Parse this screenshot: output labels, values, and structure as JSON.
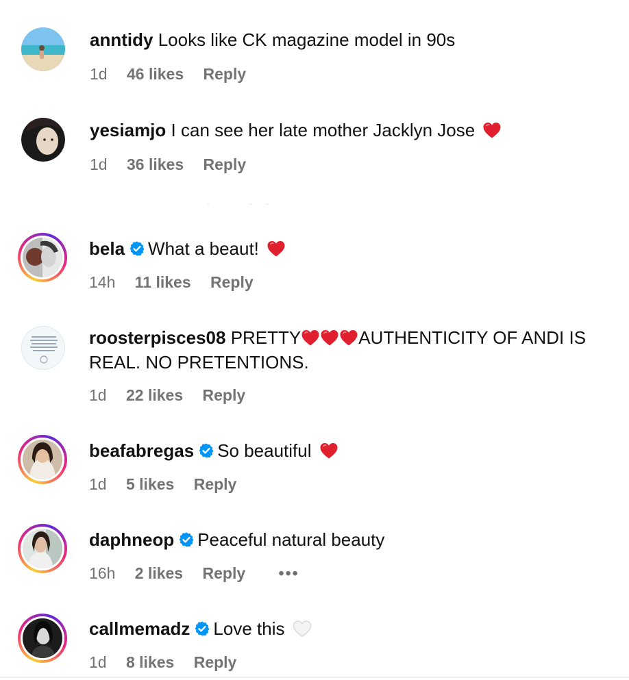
{
  "comments": [
    {
      "username": "anntidy",
      "text": "Looks like CK magazine model in 90s",
      "time": "1d",
      "likes": "46 likes",
      "reply": "Reply",
      "verified": false
    },
    {
      "username": "yesiamjo",
      "text": "I can see her late mother Jacklyn Jose",
      "time": "1d",
      "likes": "36 likes",
      "reply": "Reply",
      "verified": false
    },
    {
      "username": "bela",
      "text": "What a beaut!",
      "time": "14h",
      "likes": "11 likes",
      "reply": "Reply",
      "verified": true
    },
    {
      "username": "roosterpisces08",
      "text_a": "PRETTY",
      "text_b": "AUTHENTICITY OF ANDI IS REAL. NO PRETENTIONS.",
      "time": "1d",
      "likes": "22 likes",
      "reply": "Reply",
      "verified": false
    },
    {
      "username": "beafabregas",
      "text": "So beautiful",
      "time": "1d",
      "likes": "5 likes",
      "reply": "Reply",
      "verified": true
    },
    {
      "username": "daphneop",
      "text": "Peaceful natural beauty",
      "time": "16h",
      "likes": "2 likes",
      "reply": "Reply",
      "more": "•••",
      "verified": true
    },
    {
      "username": "callmemadz",
      "text": "Love this",
      "time": "1d",
      "likes": "8 likes",
      "reply": "Reply",
      "verified": true
    }
  ],
  "icons": {
    "verified": "verified-badge-icon",
    "heart_red": "red-heart-emoji",
    "heart_white": "white-heart-emoji",
    "more": "more-options-icon"
  },
  "colors": {
    "meta_text": "#737373",
    "verified_blue": "#0095f6",
    "heart_red": "#e0202e"
  }
}
